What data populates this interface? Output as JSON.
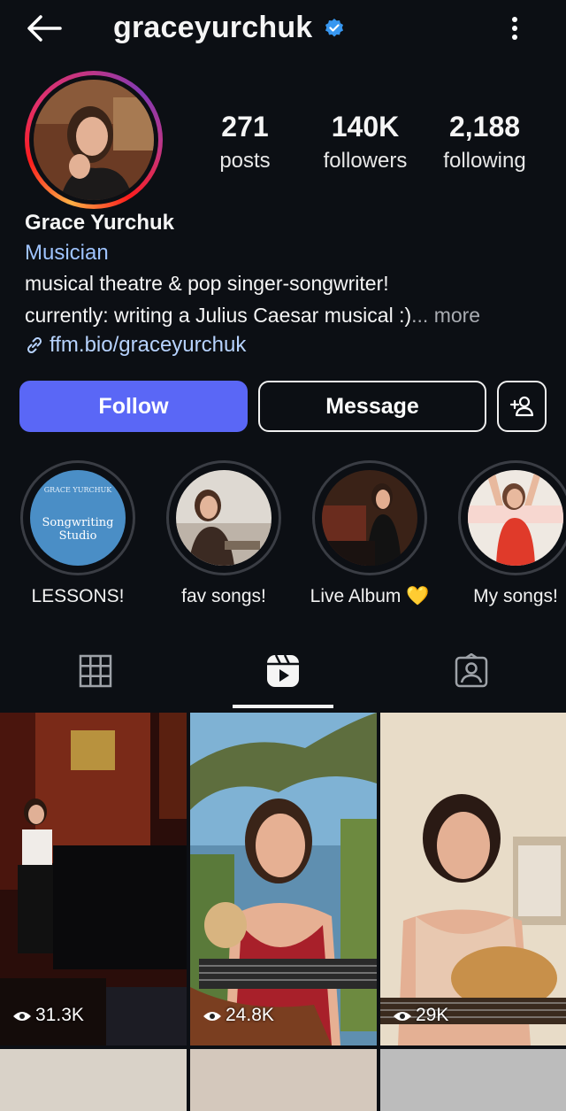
{
  "header": {
    "username": "graceyurchuk",
    "back_icon": "back-arrow-icon",
    "verified_icon": "verified-badge-icon",
    "menu_icon": "more-options-icon"
  },
  "profile": {
    "stats": [
      {
        "value": "271",
        "label": "posts"
      },
      {
        "value": "140K",
        "label": "followers"
      },
      {
        "value": "2,188",
        "label": "following"
      }
    ],
    "name": "Grace Yurchuk",
    "category": "Musician",
    "bio_line1": "musical theatre & pop singer-songwriter!",
    "bio_line2": "currently: writing a Julius Caesar musical :)",
    "bio_more": "... more",
    "link": "ffm.bio/graceyurchuk"
  },
  "actions": {
    "follow": "Follow",
    "message": "Message",
    "add_user_icon": "add-user-icon"
  },
  "highlights": [
    {
      "label": "LESSONS!",
      "cover_title": "GRACE YURCHUK",
      "cover_sub": "Songwriting Studio"
    },
    {
      "label": "fav songs!"
    },
    {
      "label": "Live Album 💛"
    },
    {
      "label": "My songs!"
    }
  ],
  "tabs": [
    {
      "icon": "grid-icon"
    },
    {
      "icon": "reels-icon",
      "active": true
    },
    {
      "icon": "tagged-icon"
    }
  ],
  "reels": [
    {
      "views": "31.3K"
    },
    {
      "views": "24.8K"
    },
    {
      "views": "29K"
    }
  ],
  "colors": {
    "accent": "#5a67f6",
    "link": "#b7d3ff",
    "background": "#0c0f14"
  }
}
